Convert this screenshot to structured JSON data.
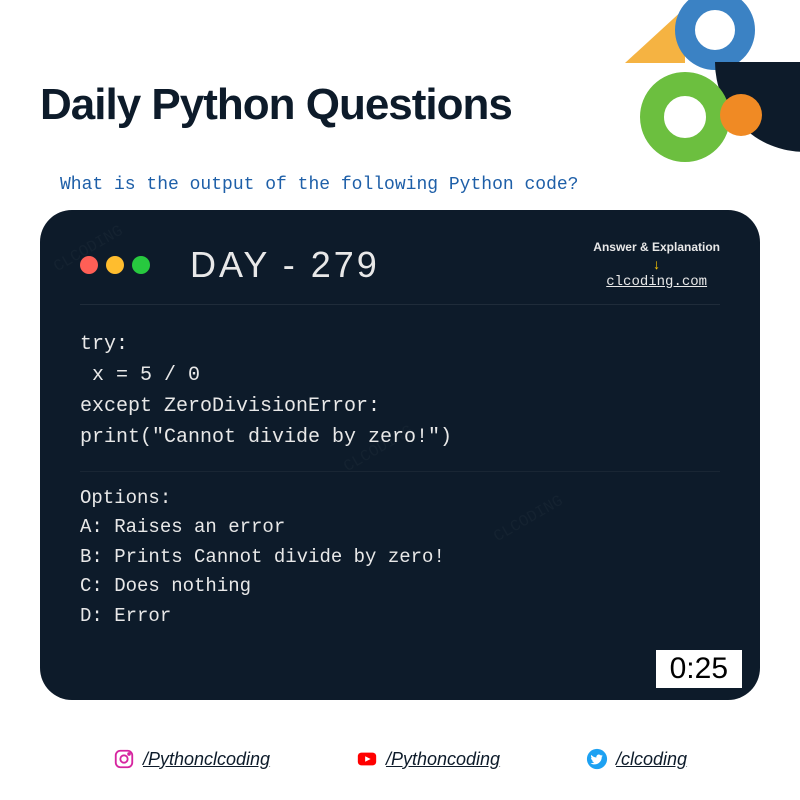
{
  "header": {
    "title": "Daily Python Questions"
  },
  "question": "What is the output of the following Python code?",
  "terminal": {
    "day_label": "DAY - 279",
    "answer_hint": "Answer & Explanation",
    "answer_site": "clcoding.com",
    "code": "try:\n x = 5 / 0\nexcept ZeroDivisionError:\nprint(\"Cannot divide by zero!\")",
    "options_label": "Options:",
    "options": [
      "A: Raises an error",
      "B: Prints Cannot divide by zero!",
      "C: Does nothing",
      "D: Error"
    ],
    "timer": "0:25"
  },
  "socials": {
    "instagram": "/Pythonclcoding",
    "youtube": "/Pythoncoding",
    "twitter": "/clcoding"
  }
}
